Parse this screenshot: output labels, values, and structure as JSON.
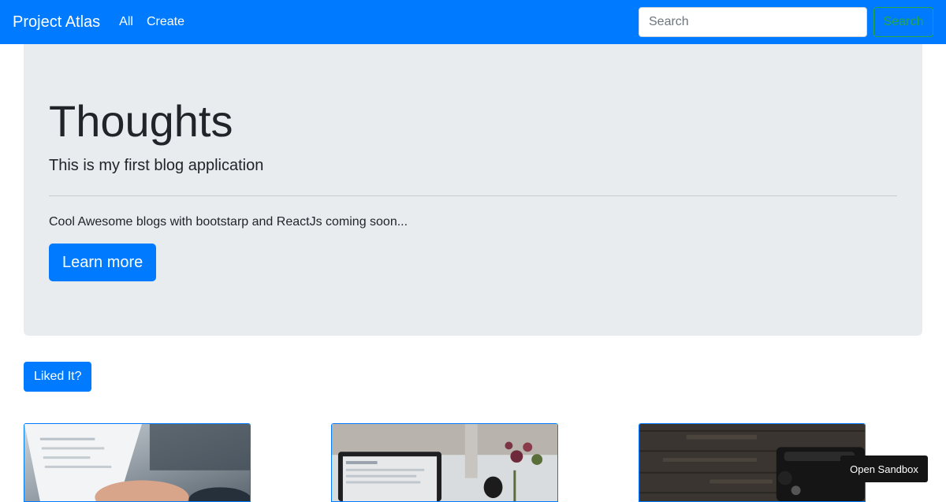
{
  "navbar": {
    "brand": "Project Atlas",
    "links": [
      {
        "label": "All"
      },
      {
        "label": "Create"
      }
    ],
    "search": {
      "placeholder": "Search",
      "value": "",
      "button_label": "Search"
    }
  },
  "jumbotron": {
    "title": "Thoughts",
    "lead": "This is my first blog application",
    "description": "Cool Awesome blogs with bootstarp and ReactJs coming soon...",
    "button_label": "Learn more"
  },
  "liked_button_label": "Liked It?",
  "cards": [
    {
      "image": "laptop-screen-hands-photo"
    },
    {
      "image": "laptop-desk-flowers-photo"
    },
    {
      "image": "typewriter-wood-photo"
    }
  ],
  "sandbox_button_label": "Open Sandbox",
  "colors": {
    "primary": "#007bff",
    "success": "#28a745",
    "jumbotron_bg": "#e9ecef",
    "text": "#212529"
  }
}
